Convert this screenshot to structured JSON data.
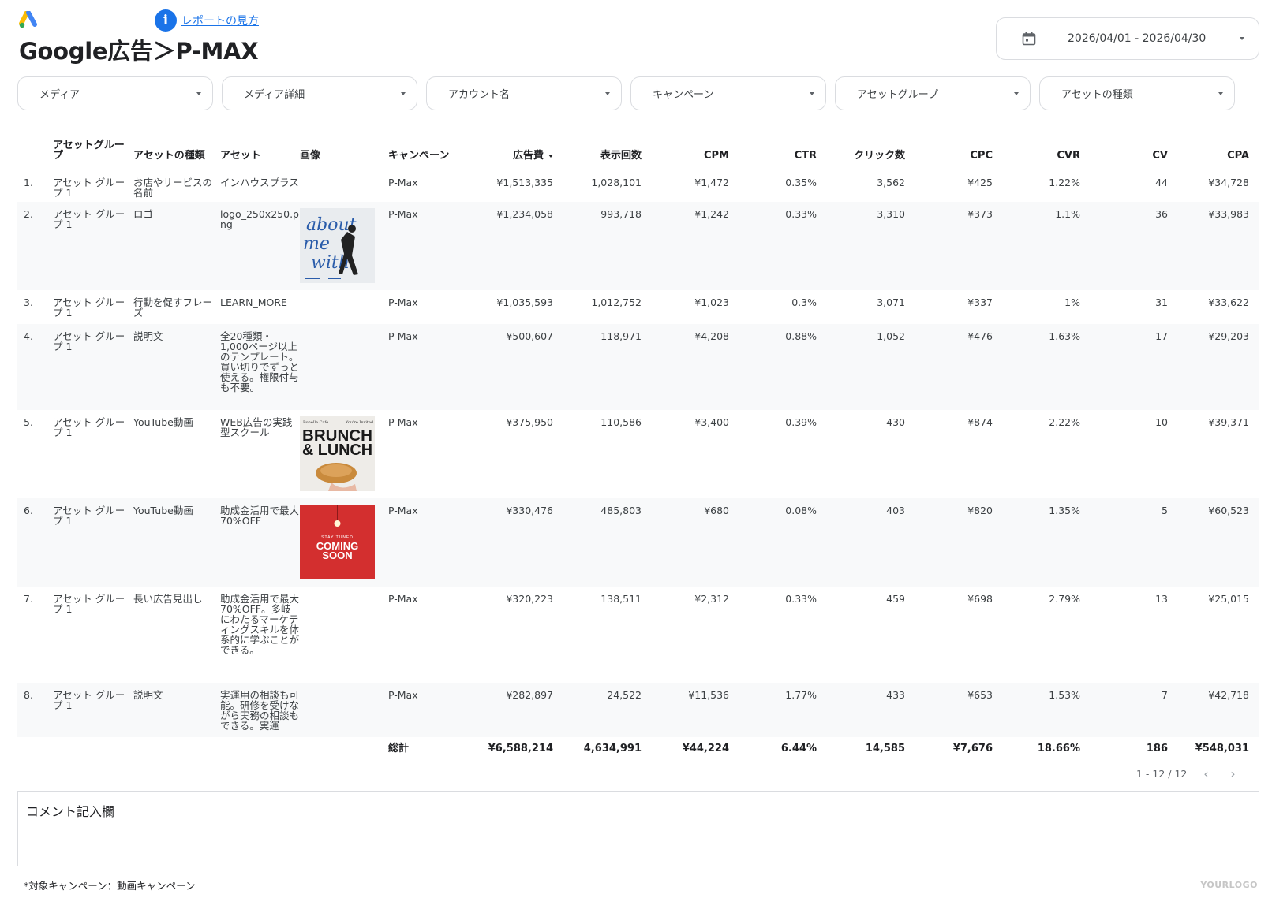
{
  "header": {
    "help_link": "レポートの見方",
    "help_icon_letter": "i",
    "title": "Google広告＞P-MAX",
    "date_range": "2026/04/01 - 2026/04/30"
  },
  "filters": [
    "メディア",
    "メディア詳細",
    "アカウント名",
    "キャンペーン",
    "アセットグループ",
    "アセットの種類"
  ],
  "table": {
    "columns": {
      "idx": "",
      "group": "アセットグループ",
      "type": "アセットの種類",
      "asset": "アセット",
      "image": "画像",
      "campaign": "キャンペーン",
      "spend": "広告費",
      "impressions": "表示回数",
      "cpm": "CPM",
      "ctr": "CTR",
      "clicks": "クリック数",
      "cpc": "CPC",
      "cvr": "CVR",
      "cv": "CV",
      "cpa": "CPA"
    },
    "rows": [
      {
        "idx": "1.",
        "group": "アセット グループ 1",
        "type": "お店やサービスの名前",
        "asset": "インハウスプラス",
        "image": "",
        "campaign": "P-Max",
        "spend": "¥1,513,335",
        "impressions": "1,028,101",
        "cpm": "¥1,472",
        "ctr": "0.35%",
        "clicks": "3,562",
        "cpc": "¥425",
        "cvr": "1.22%",
        "cv": "44",
        "cpa": "¥34,728"
      },
      {
        "idx": "2.",
        "group": "アセット グループ 1",
        "type": "ロゴ",
        "asset": "logo_250x250.png",
        "image": "about",
        "campaign": "P-Max",
        "spend": "¥1,234,058",
        "impressions": "993,718",
        "cpm": "¥1,242",
        "ctr": "0.33%",
        "clicks": "3,310",
        "cpc": "¥373",
        "cvr": "1.1%",
        "cv": "36",
        "cpa": "¥33,983"
      },
      {
        "idx": "3.",
        "group": "アセット グループ 1",
        "type": "行動を促すフレーズ",
        "asset": "LEARN_MORE",
        "image": "",
        "campaign": "P-Max",
        "spend": "¥1,035,593",
        "impressions": "1,012,752",
        "cpm": "¥1,023",
        "ctr": "0.3%",
        "clicks": "3,071",
        "cpc": "¥337",
        "cvr": "1%",
        "cv": "31",
        "cpa": "¥33,622"
      },
      {
        "idx": "4.",
        "group": "アセット グループ 1",
        "type": "説明文",
        "asset": "全20種類・1,000ページ以上のテンプレート。買い切りでずっと使える。権限付与も不要。",
        "image": "",
        "campaign": "P-Max",
        "spend": "¥500,607",
        "impressions": "118,971",
        "cpm": "¥4,208",
        "ctr": "0.88%",
        "clicks": "1,052",
        "cpc": "¥476",
        "cvr": "1.63%",
        "cv": "17",
        "cpa": "¥29,203"
      },
      {
        "idx": "5.",
        "group": "アセット グループ 1",
        "type": "YouTube動画",
        "asset": "WEB広告の実践型スクール",
        "image": "brunch",
        "campaign": "P-Max",
        "spend": "¥375,950",
        "impressions": "110,586",
        "cpm": "¥3,400",
        "ctr": "0.39%",
        "clicks": "430",
        "cpc": "¥874",
        "cvr": "2.22%",
        "cv": "10",
        "cpa": "¥39,371"
      },
      {
        "idx": "6.",
        "group": "アセット グループ 1",
        "type": "YouTube動画",
        "asset": "助成金活用で最大70%OFF",
        "image": "coming",
        "campaign": "P-Max",
        "spend": "¥330,476",
        "impressions": "485,803",
        "cpm": "¥680",
        "ctr": "0.08%",
        "clicks": "403",
        "cpc": "¥820",
        "cvr": "1.35%",
        "cv": "5",
        "cpa": "¥60,523"
      },
      {
        "idx": "7.",
        "group": "アセット グループ 1",
        "type": "長い広告見出し",
        "asset": "助成金活用で最大70%OFF。多岐にわたるマーケティングスキルを体系的に学ぶことができる。",
        "image": "",
        "campaign": "P-Max",
        "spend": "¥320,223",
        "impressions": "138,511",
        "cpm": "¥2,312",
        "ctr": "0.33%",
        "clicks": "459",
        "cpc": "¥698",
        "cvr": "2.79%",
        "cv": "13",
        "cpa": "¥25,015"
      },
      {
        "idx": "8.",
        "group": "アセット グループ 1",
        "type": "説明文",
        "asset": "実運用の相談も可能。研修を受けながら実務の相談もできる。実運",
        "image": "",
        "campaign": "P-Max",
        "spend": "¥282,897",
        "impressions": "24,522",
        "cpm": "¥11,536",
        "ctr": "1.77%",
        "clicks": "433",
        "cpc": "¥653",
        "cvr": "1.53%",
        "cv": "7",
        "cpa": "¥42,718"
      }
    ],
    "thumbs": {
      "about": {
        "line1": "about",
        "line2": "me",
        "line3": "with"
      },
      "brunch": {
        "top_left": "Bonelle Cafe",
        "top_right": "You're Invited",
        "line1": "BRUNCH",
        "line2": "& LUNCH"
      },
      "coming": {
        "small": "STAY TUNED",
        "line1": "COMING",
        "line2": "SOON"
      }
    },
    "totals": {
      "label": "総計",
      "spend": "¥6,588,214",
      "impressions": "4,634,991",
      "cpm": "¥44,224",
      "ctr": "6.44%",
      "clicks": "14,585",
      "cpc": "¥7,676",
      "cvr": "18.66%",
      "cv": "186",
      "cpa": "¥548,031"
    },
    "pagination": "1 - 12 / 12"
  },
  "comment_label": "コメント記入欄",
  "footnote": "*対象キャンペーン：動画キャンペーン",
  "watermark": "YOURLOGO",
  "colors": {
    "accent": "#1a73e8",
    "coming_soon_bg": "#d32f2f",
    "row_shade": "#f8f9fa"
  }
}
